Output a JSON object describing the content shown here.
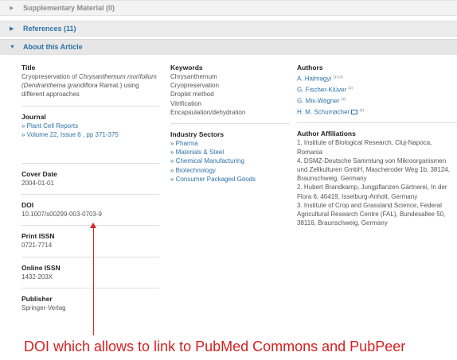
{
  "sections": {
    "supplementary": "Supplementary Material (0)",
    "references": "References (11)",
    "about": "About this Article"
  },
  "article": {
    "title_label": "Title",
    "title_prefix": "Cryopreservation of ",
    "title_species": "Chrysanthemum morifolium (Dendranthema grandiflora",
    "title_suffix": " Ramat.) using different approaches",
    "journal_label": "Journal",
    "journal_name": "» Plant Cell Reports",
    "journal_volume": "» Volume 22, Issue 6 , pp 371-375",
    "cover_date_label": "Cover Date",
    "cover_date": "2004-01-01",
    "doi_label": "DOI",
    "doi": "10.1007/s00299-003-0703-9",
    "print_issn_label": "Print ISSN",
    "print_issn": "0721-7714",
    "online_issn_label": "Online ISSN",
    "online_issn": "1432-203X",
    "publisher_label": "Publisher",
    "publisher": "Springer-Verlag"
  },
  "keywords": {
    "label": "Keywords",
    "items": [
      "Chrysanthemum",
      "Cryopreservation",
      "Droplet method",
      "Vitrification",
      "Encapsulation/dehydration"
    ]
  },
  "industry": {
    "label": "Industry Sectors",
    "items": [
      "» Pharma",
      "» Materials & Steel",
      "» Chemical Manufacturing",
      "» Biotechnology",
      "» Consumer Packaged Goods"
    ]
  },
  "authors": {
    "label": "Authors",
    "items": [
      {
        "name": "A. Halmagyi",
        "sup": "(1) (4)"
      },
      {
        "name": "G. Fischer-Klüver",
        "sup": "(2)"
      },
      {
        "name": "G. Mix-Wagner",
        "sup": "(2)"
      },
      {
        "name": "H. M. Schumacher",
        "sup": "(4)"
      }
    ]
  },
  "affiliations": {
    "label": "Author Affiliations",
    "items": [
      "1. Institute of Biological Research, Cluj-Napoca, Romania",
      "4. DSMZ-Deutsche Sammlung von Mikroorganismen und Zellkulturen GmbH, Mascheroder Weg 1b, 38124, Braunschweig, Germany",
      "2. Hubert Brandkamp, Jungpflanzen Gärtnerei, In der Flora 6, 46419, Isselburg-Anholt, Germany",
      "3. Institute of Crop and Grassland Science, Federal Agricultural Research Centre (FAL), Bundesallee 50, 38116, Braunschweig, Germany"
    ]
  },
  "annotation": "DOI which allows to link to PubMed Commons and PubPeer",
  "colors": {
    "link": "#2d73a8",
    "annotation": "#d61f1f"
  },
  "icons": {
    "collapsed": "triangle-right-icon",
    "expanded": "triangle-down-icon",
    "email": "envelope-icon"
  }
}
